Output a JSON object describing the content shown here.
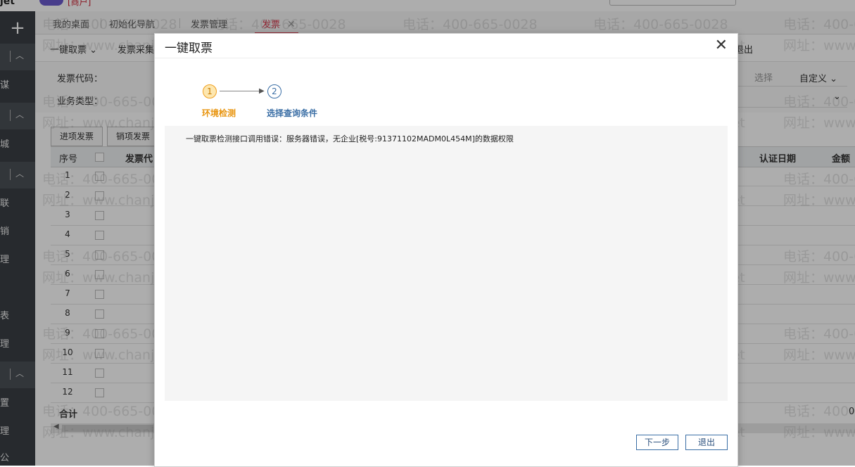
{
  "topbar": {
    "brand": "jet",
    "text": "[商户]"
  },
  "sidebar": {
    "add_icon": "plus-icon",
    "items": [
      "谋",
      "城",
      "联",
      "销",
      "理",
      "表",
      "理",
      "置",
      "理",
      "公"
    ]
  },
  "tabs": [
    {
      "label": "我的桌面"
    },
    {
      "label": "初始化导航"
    },
    {
      "label": "发票管理"
    },
    {
      "label": "发票",
      "close": "✕"
    }
  ],
  "toolbar": {
    "fetch_label": "一键取票",
    "collect_label": "发票采集",
    "exit_label": "退出",
    "choose_label": "选择",
    "custom_label": "自定义"
  },
  "filter": {
    "invoice_code": "发票代码：",
    "biz_type": "业务类型："
  },
  "grid": {
    "btn_in": "进项发票",
    "btn_out": "销项发票",
    "col_no": "序号",
    "col_code": "发票代",
    "col_auth": "认证日期",
    "col_amount": "金额",
    "rows": [
      "1",
      "2",
      "3",
      "4",
      "5",
      "6",
      "7",
      "8",
      "9",
      "10",
      "11",
      "12"
    ],
    "total": "合计",
    "total_value": "0"
  },
  "watermark": {
    "phone": "电话：400-665-0028",
    "site": "网址：www.chanjet.net"
  },
  "modal": {
    "title": "一键取票",
    "close": "✕",
    "steps": [
      {
        "num": "1",
        "label": "环境检测"
      },
      {
        "num": "2",
        "label": "选择查询条件"
      }
    ],
    "message": "一键取票检测接口调用错误：服务器错误，无企业[税号:91371102MADM0L454M]的数据权限",
    "next_label": "下一步",
    "exit_label": "退出"
  }
}
